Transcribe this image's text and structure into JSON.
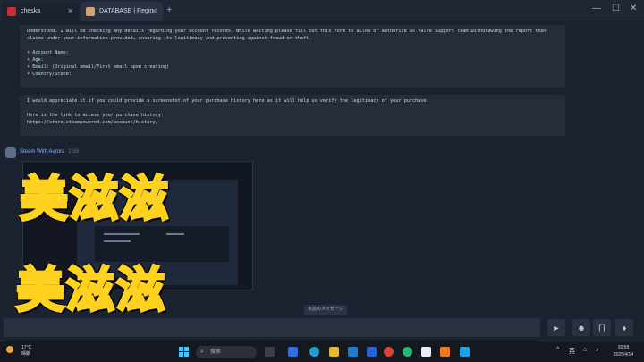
{
  "tabs": [
    {
      "label": "cheska",
      "avatar_color": "#c9302c"
    },
    {
      "label": "DATABASE | Regin",
      "avatar_color": "#d4a373"
    }
  ],
  "window_controls": {
    "minimize": "—",
    "maximize": "☐",
    "close": "✕"
  },
  "messages": [
    {
      "paragraph": "Understood. I will be checking any details regarding your account records. While waiting please fill out this form to allow or authorize as Valve Support Team withdrawing the report that claims under your information provided, ensuring its legitimacy and preventing against fraud or theft.",
      "form": [
        {
          "bullet": "♦",
          "label": "Account Name:"
        },
        {
          "bullet": "♦",
          "label": "Age:"
        },
        {
          "bullet": "♦",
          "label": "Email: (Original email/First email upon creating)"
        },
        {
          "bullet": "♦",
          "label": "Country/State:"
        }
      ]
    },
    {
      "paragraph": "I would appreciate it if you could provide a screenshot of your purchase history here as it will help us verify the legitimacy of your purchase.",
      "link_intro": "Here is the link to access your purchase history:",
      "link": "https://store.steampowered.com/account/history/"
    }
  ],
  "sender": {
    "name": "Steam With Aurora",
    "time": "2:58"
  },
  "watermark": {
    "text": "美滋滋",
    "fill_color": "#ff3d1f",
    "outline_color": "#ffd21f"
  },
  "unread_pill": "未読のメッセージ",
  "composer": {
    "placeholder": "",
    "send_icon": "send-icon"
  },
  "taskbar": {
    "weather_temp": "17°C",
    "weather_desc": "晴朗",
    "search_placeholder": "搜索",
    "lang": "英",
    "time": "20:58",
    "date": "2025/4/14"
  },
  "colors": {
    "accent": "#4cc2ff",
    "bg": "#1b2230",
    "message_bg": "#262d3a"
  }
}
